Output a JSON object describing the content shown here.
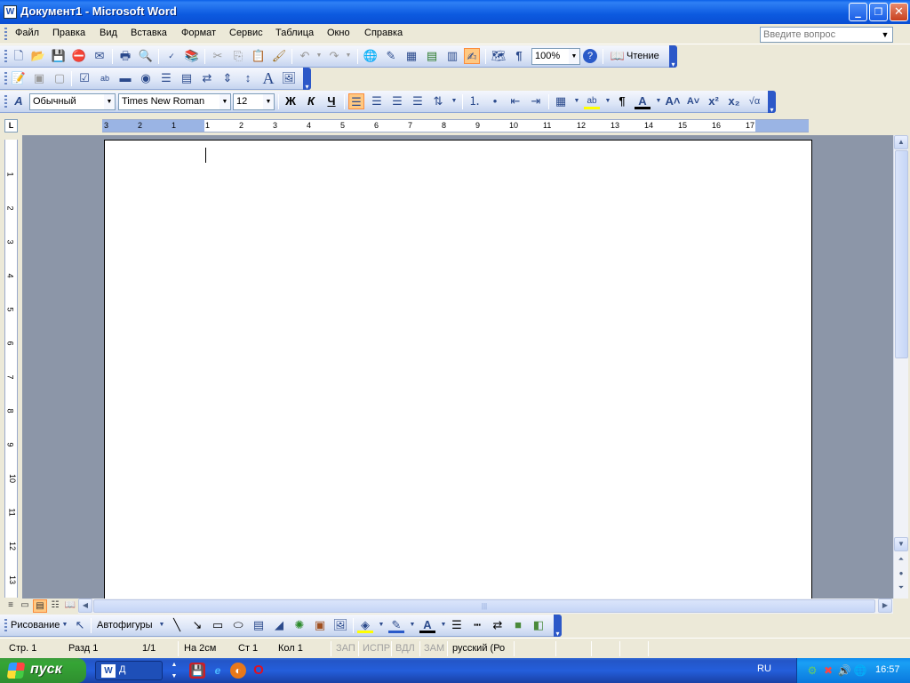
{
  "window": {
    "title": "Документ1 - Microsoft Word",
    "app_icon_letter": "W",
    "minimize": "_",
    "maximize": "❐",
    "close": "✕"
  },
  "menu": {
    "items": [
      "Файл",
      "Правка",
      "Вид",
      "Вставка",
      "Формат",
      "Сервис",
      "Таблица",
      "Окно",
      "Справка"
    ],
    "help_placeholder": "Введите вопрос"
  },
  "standard_toolbar": {
    "zoom": "100%",
    "reading_label": "Чтение"
  },
  "format_toolbar": {
    "style": "Обычный",
    "font": "Times New Roman",
    "size": "12",
    "bold": "Ж",
    "italic": "К",
    "underline": "Ч",
    "pilcrow": "¶"
  },
  "ruler": {
    "h_numbers": [
      "3",
      "2",
      "1",
      "1",
      "2",
      "3",
      "4",
      "5",
      "6",
      "7",
      "8",
      "9",
      "10",
      "11",
      "12",
      "13",
      "14",
      "15",
      "16",
      "17"
    ],
    "v_numbers": [
      "1",
      "2",
      "3",
      "4",
      "5",
      "6",
      "7",
      "8",
      "9",
      "10",
      "11",
      "12",
      "13"
    ]
  },
  "drawing_toolbar": {
    "drawing_label": "Рисование",
    "autoshapes_label": "Автофигуры"
  },
  "status": {
    "page": "Стр. 1",
    "section": "Разд 1",
    "pages": "1/1",
    "at": "На 2см",
    "line": "Ст 1",
    "col": "Кол 1",
    "rec": "ЗАП",
    "trk": "ИСПР",
    "ext": "ВДЛ",
    "ovr": "ЗАМ",
    "language": "русский (Ро"
  },
  "taskbar": {
    "start": "пуск",
    "word_task": "Д",
    "lang": "RU",
    "time": "16:57"
  },
  "colors": {
    "titlebar": "#0a5fe8",
    "taskbar": "#245edb",
    "start": "#35a535",
    "doc_background": "#8c96a8"
  }
}
